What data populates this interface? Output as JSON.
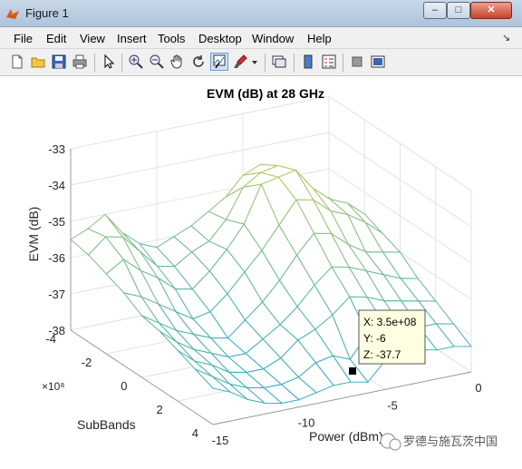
{
  "window": {
    "title": "Figure 1",
    "minimize": "–",
    "maximize": "□",
    "close": "✕"
  },
  "menu": [
    "File",
    "Edit",
    "View",
    "Insert",
    "Tools",
    "Desktop",
    "Window",
    "Help"
  ],
  "menu_arrow": "↘",
  "toolbar_icons": [
    "new-figure-icon",
    "open-file-icon",
    "save-icon",
    "print-icon",
    "edit-plot-arrow-icon",
    "zoom-in-icon",
    "zoom-out-icon",
    "pan-hand-icon",
    "rotate-3d-icon",
    "data-cursor-icon",
    "brush-icon",
    "brush-dropdown-icon",
    "link-plot-icon",
    "colorbar-icon",
    "legend-icon",
    "hide-plot-tools-icon",
    "show-plot-tools-icon"
  ],
  "chart_data": {
    "type": "surface-mesh",
    "title": "EVM (dB) at 28 GHz",
    "xlabel": "Power (dBm)",
    "ylabel": "SubBands",
    "zlabel": "EVM (dB)",
    "y_exponent": "×10⁸",
    "xticks": [
      "-15",
      "-10",
      "-5",
      "0"
    ],
    "yticks": [
      "-4",
      "-2",
      "0",
      "2",
      "4"
    ],
    "zticks": [
      "-33",
      "-34",
      "-35",
      "-36",
      "-37",
      "-38"
    ],
    "xlim": [
      -15,
      0
    ],
    "ylim": [
      -400000000.0,
      400000000.0
    ],
    "zlim": [
      -38,
      -33
    ],
    "power_dbm": [
      -15,
      -14,
      -13,
      -12,
      -11,
      -10,
      -9,
      -8,
      -7,
      -6,
      -5,
      -4,
      -3,
      -2,
      -1,
      0
    ],
    "subbands": [
      -400000000.0,
      -300000000.0,
      -200000000.0,
      -100000000.0,
      0,
      100000000.0,
      200000000.0,
      300000000.0,
      400000000.0
    ],
    "evm_db": [
      [
        -35.5,
        -35.3,
        -35.0,
        -35.6,
        -36.0,
        -36.2,
        -36.0,
        -35.8,
        -35.5,
        -35.2,
        -34.7,
        -34.5,
        -35.0,
        -35.3,
        -35.6,
        -35.8
      ],
      [
        -35.6,
        -35.2,
        -35.3,
        -35.8,
        -36.3,
        -36.4,
        -36.1,
        -35.9,
        -35.4,
        -34.6,
        -34.3,
        -34.2,
        -34.6,
        -35.1,
        -35.5,
        -35.8
      ],
      [
        -35.8,
        -35.5,
        -35.9,
        -36.2,
        -36.6,
        -36.7,
        -36.3,
        -35.8,
        -35.2,
        -34.2,
        -34.1,
        -34.0,
        -34.6,
        -35.0,
        -35.2,
        -35.6
      ],
      [
        -36.0,
        -36.2,
        -36.5,
        -36.8,
        -37.1,
        -37.0,
        -36.6,
        -36.1,
        -35.6,
        -35.0,
        -34.4,
        -34.5,
        -34.9,
        -35.1,
        -35.4,
        -35.8
      ],
      [
        -36.3,
        -36.6,
        -36.9,
        -37.1,
        -37.3,
        -37.4,
        -37.0,
        -36.6,
        -36.1,
        -35.5,
        -35.0,
        -35.1,
        -35.5,
        -35.8,
        -35.9,
        -36.0
      ],
      [
        -36.4,
        -36.8,
        -37.1,
        -37.3,
        -37.5,
        -37.5,
        -37.2,
        -36.9,
        -36.5,
        -36.0,
        -35.6,
        -35.7,
        -35.9,
        -36.1,
        -36.3,
        -36.4
      ],
      [
        -36.6,
        -37.0,
        -37.2,
        -37.5,
        -37.6,
        -37.6,
        -37.4,
        -37.0,
        -36.8,
        -36.5,
        -36.1,
        -36.2,
        -36.4,
        -36.5,
        -36.6,
        -36.7
      ],
      [
        -36.8,
        -37.1,
        -37.4,
        -37.6,
        -37.7,
        -37.7,
        -37.6,
        -37.3,
        -37.2,
        -37.4,
        -36.8,
        -36.6,
        -36.8,
        -36.9,
        -36.9,
        -37.0
      ],
      [
        -37.0,
        -37.2,
        -37.5,
        -37.7,
        -37.8,
        -37.8,
        -37.7,
        -37.6,
        -37.6,
        -37.7,
        -37.2,
        -37.0,
        -37.1,
        -37.2,
        -37.2,
        -37.3
      ]
    ],
    "datatip": {
      "x": "X: 3.5e+08",
      "y": "Y: -6",
      "z": "Z: -37.7"
    }
  },
  "watermark": "罗德与施瓦茨中国"
}
